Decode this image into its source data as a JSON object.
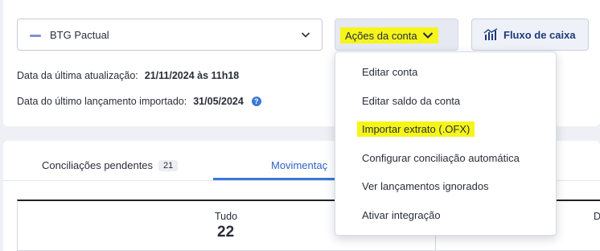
{
  "account": {
    "bank_name": "BTG Pactual",
    "bank_logo_icon": "btg-logo-icon"
  },
  "actions_button": {
    "label": "Ações da conta",
    "icon": "chevron-down-icon"
  },
  "cashflow_button": {
    "label": "Fluxo de caixa",
    "icon": "chart-icon"
  },
  "meta": {
    "last_update_label": "Data da última atualização:",
    "last_update_value": "21/11/2024 às 11h18",
    "last_import_label": "Data do último lançamento importado:",
    "last_import_value": "31/05/2024",
    "help_icon": "?"
  },
  "tabs": {
    "pending_label": "Conciliações pendentes",
    "pending_count": "21",
    "movements_label": "Movimentaç"
  },
  "summary": {
    "all_label": "Tudo",
    "all_value": "22",
    "next_label_partial": "D"
  },
  "dropdown": {
    "items": [
      "Editar conta",
      "Editar saldo da conta",
      "Importar extrato (.OFX)",
      "Configurar conciliação automática",
      "Ver lançamentos ignorados",
      "Ativar integração"
    ]
  },
  "colors": {
    "highlight": "#f5f51a",
    "accent_blue": "#3a78d8",
    "background": "#eef0f5"
  }
}
